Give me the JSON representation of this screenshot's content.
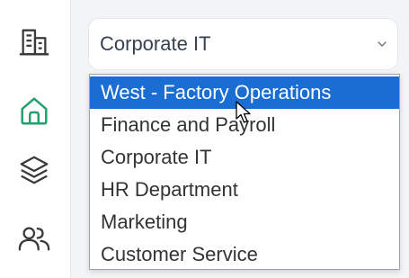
{
  "sidebar": {
    "items": [
      {
        "icon": "building-icon",
        "active": false
      },
      {
        "icon": "home-icon",
        "active": true
      },
      {
        "icon": "layers-icon",
        "active": false
      },
      {
        "icon": "users-icon",
        "active": false
      }
    ],
    "active_color": "#22a06b",
    "icon_color": "#3a3a3a"
  },
  "select": {
    "value": "Corporate IT",
    "options": [
      "West - Factory Operations",
      "Finance and Payroll",
      "Corporate IT",
      "HR Department",
      "Marketing",
      "Customer Service"
    ],
    "highlighted_index": 0,
    "highlight_color": "#1a6dd2"
  }
}
